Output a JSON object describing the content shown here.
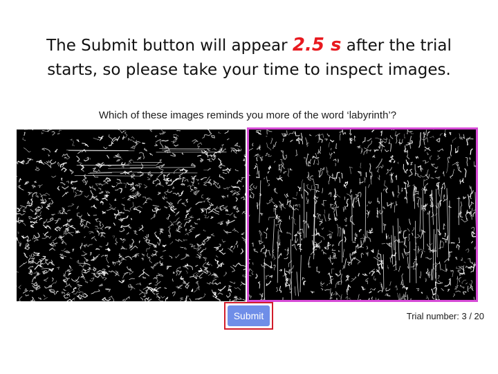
{
  "instruction": {
    "before": "The Submit button will appear ",
    "delay": "2.5 s",
    "after": " after the trial",
    "line2": "starts, so please take your time to inspect images."
  },
  "question": "Which of these images reminds you more of the word ‘labyrinth’?",
  "images": {
    "left_name": "edge-image-left",
    "right_name": "edge-image-right",
    "selected": "right"
  },
  "submit_label": "Submit",
  "trial": {
    "label": "Trial number:",
    "current": "3",
    "total": "20",
    "text": "Trial number: 3 / 20"
  },
  "colors": {
    "delay_text": "#e8191f",
    "selection_border": "#d64bd6",
    "submit_bg": "#6f8ee8",
    "submit_highlight": "#d11d2b"
  }
}
